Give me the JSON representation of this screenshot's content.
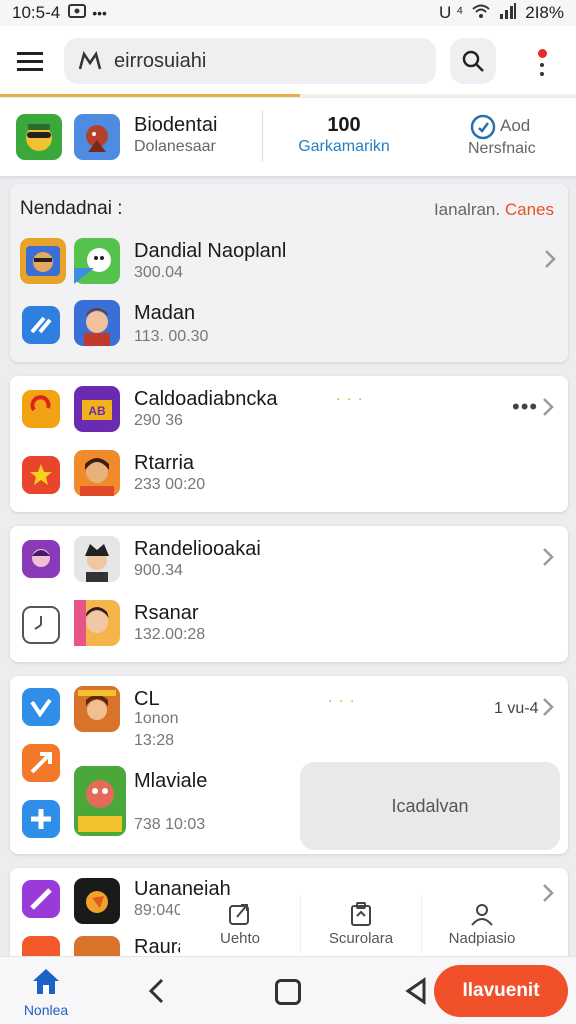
{
  "status_bar": {
    "time": "10:5-4",
    "icons_right": "U ⁴",
    "battery": "2I8%"
  },
  "search": {
    "value": "eirrosuiahi"
  },
  "stats": {
    "title": "Biodentai",
    "subtitle": "Dolanesaar",
    "count": "100",
    "count_label": "Garkamarikn",
    "add_label": "Aod",
    "add_sub": "Nersfnaic"
  },
  "section": {
    "title": "Nendadnai :",
    "link_prefix": "Ianalran.",
    "link_accent": "Canes"
  },
  "items": [
    {
      "name": "Dandial Naoplanl",
      "meta": "300.04"
    },
    {
      "name": "Madan",
      "meta": "113. 00.30"
    },
    {
      "name": "Caldoadiabncka",
      "meta": "290 36"
    },
    {
      "name": "Rtarria",
      "meta": "233 00:20"
    },
    {
      "name": "Randeliooakai",
      "meta": "900.34"
    },
    {
      "name": "Rsanar",
      "meta": "132.00:28"
    },
    {
      "name": "CL",
      "meta": "1onon",
      "meta2": "13:28"
    },
    {
      "name": "Mlaviale",
      "meta": "738 10:03"
    },
    {
      "name": "Uananeiah",
      "meta": "89:040"
    },
    {
      "name": "Raura"
    }
  ],
  "card4_right_text": "1 vu-4",
  "popup_text": "Icadalvan",
  "float_bar": [
    {
      "label": "Uehto"
    },
    {
      "label": "Scurolara"
    },
    {
      "label": "Nadpiasio"
    }
  ],
  "bottom_nav": {
    "home_label": "Nonlea",
    "cta_label": "Ilavuenit"
  },
  "colors": {
    "accent": "#f0502a",
    "link": "#2580c4",
    "nav_blue": "#1c61c4"
  }
}
